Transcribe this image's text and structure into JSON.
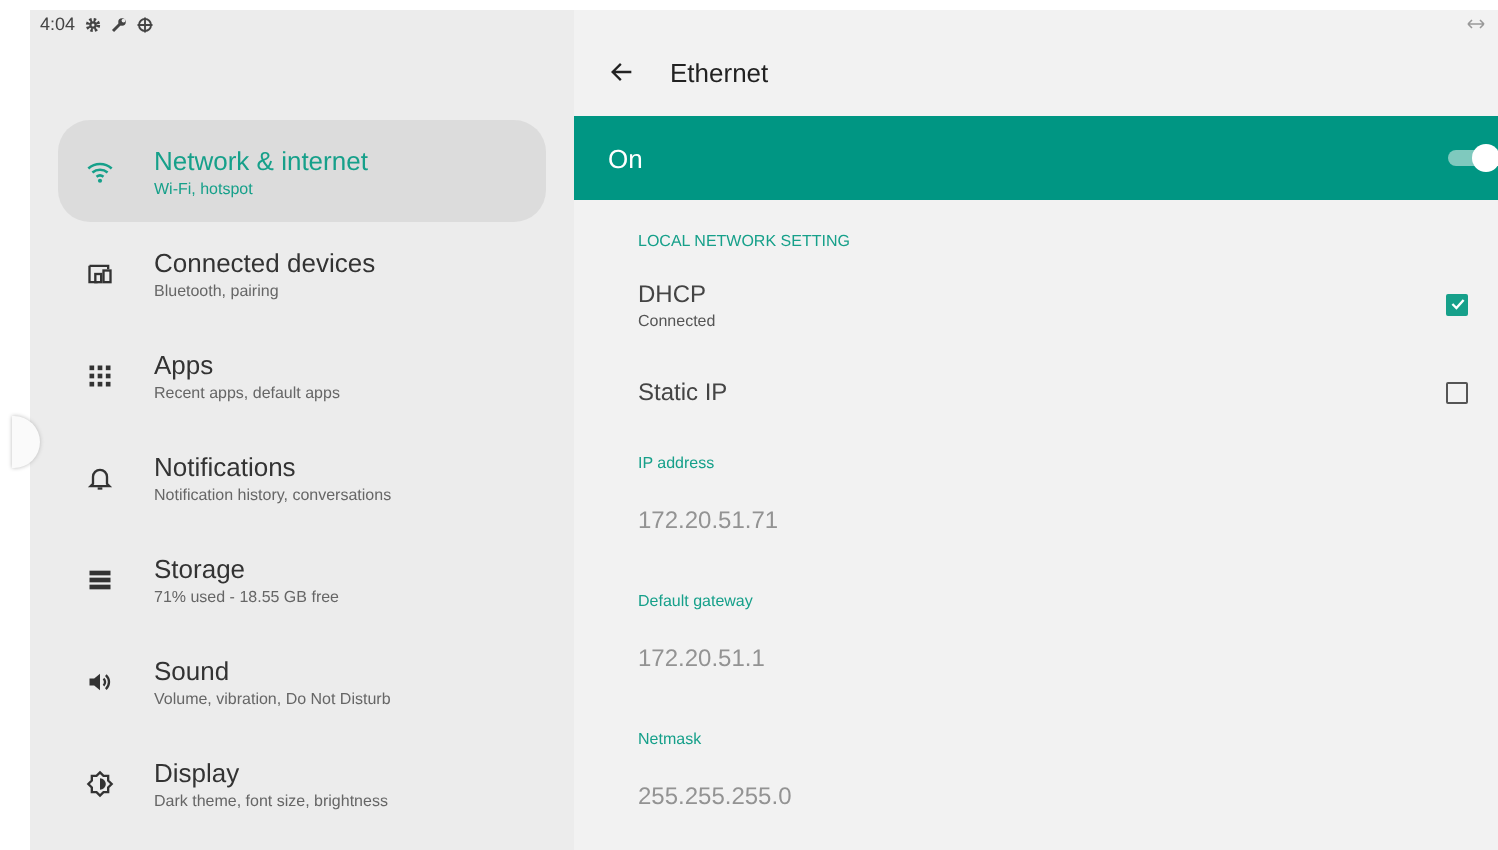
{
  "status_bar": {
    "time": "4:04"
  },
  "sidebar": {
    "items": [
      {
        "title": "Network & internet",
        "subtitle": "Wi-Fi, hotspot",
        "selected": true
      },
      {
        "title": "Connected devices",
        "subtitle": "Bluetooth, pairing",
        "selected": false
      },
      {
        "title": "Apps",
        "subtitle": "Recent apps, default apps",
        "selected": false
      },
      {
        "title": "Notifications",
        "subtitle": "Notification history, conversations",
        "selected": false
      },
      {
        "title": "Storage",
        "subtitle": "71% used - 18.55 GB free",
        "selected": false
      },
      {
        "title": "Sound",
        "subtitle": "Volume, vibration, Do Not Disturb",
        "selected": false
      },
      {
        "title": "Display",
        "subtitle": "Dark theme, font size, brightness",
        "selected": false
      }
    ]
  },
  "header": {
    "title": "Ethernet"
  },
  "master_switch": {
    "label": "On",
    "on": true
  },
  "section": {
    "title": "LOCAL NETWORK SETTING"
  },
  "options": [
    {
      "title": "DHCP",
      "subtitle": "Connected",
      "checked": true
    },
    {
      "title": "Static IP",
      "checked": false
    }
  ],
  "fields": [
    {
      "label": "IP address",
      "value": "172.20.51.71"
    },
    {
      "label": "Default gateway",
      "value": "172.20.51.1"
    },
    {
      "label": "Netmask",
      "value": "255.255.255.0"
    }
  ]
}
